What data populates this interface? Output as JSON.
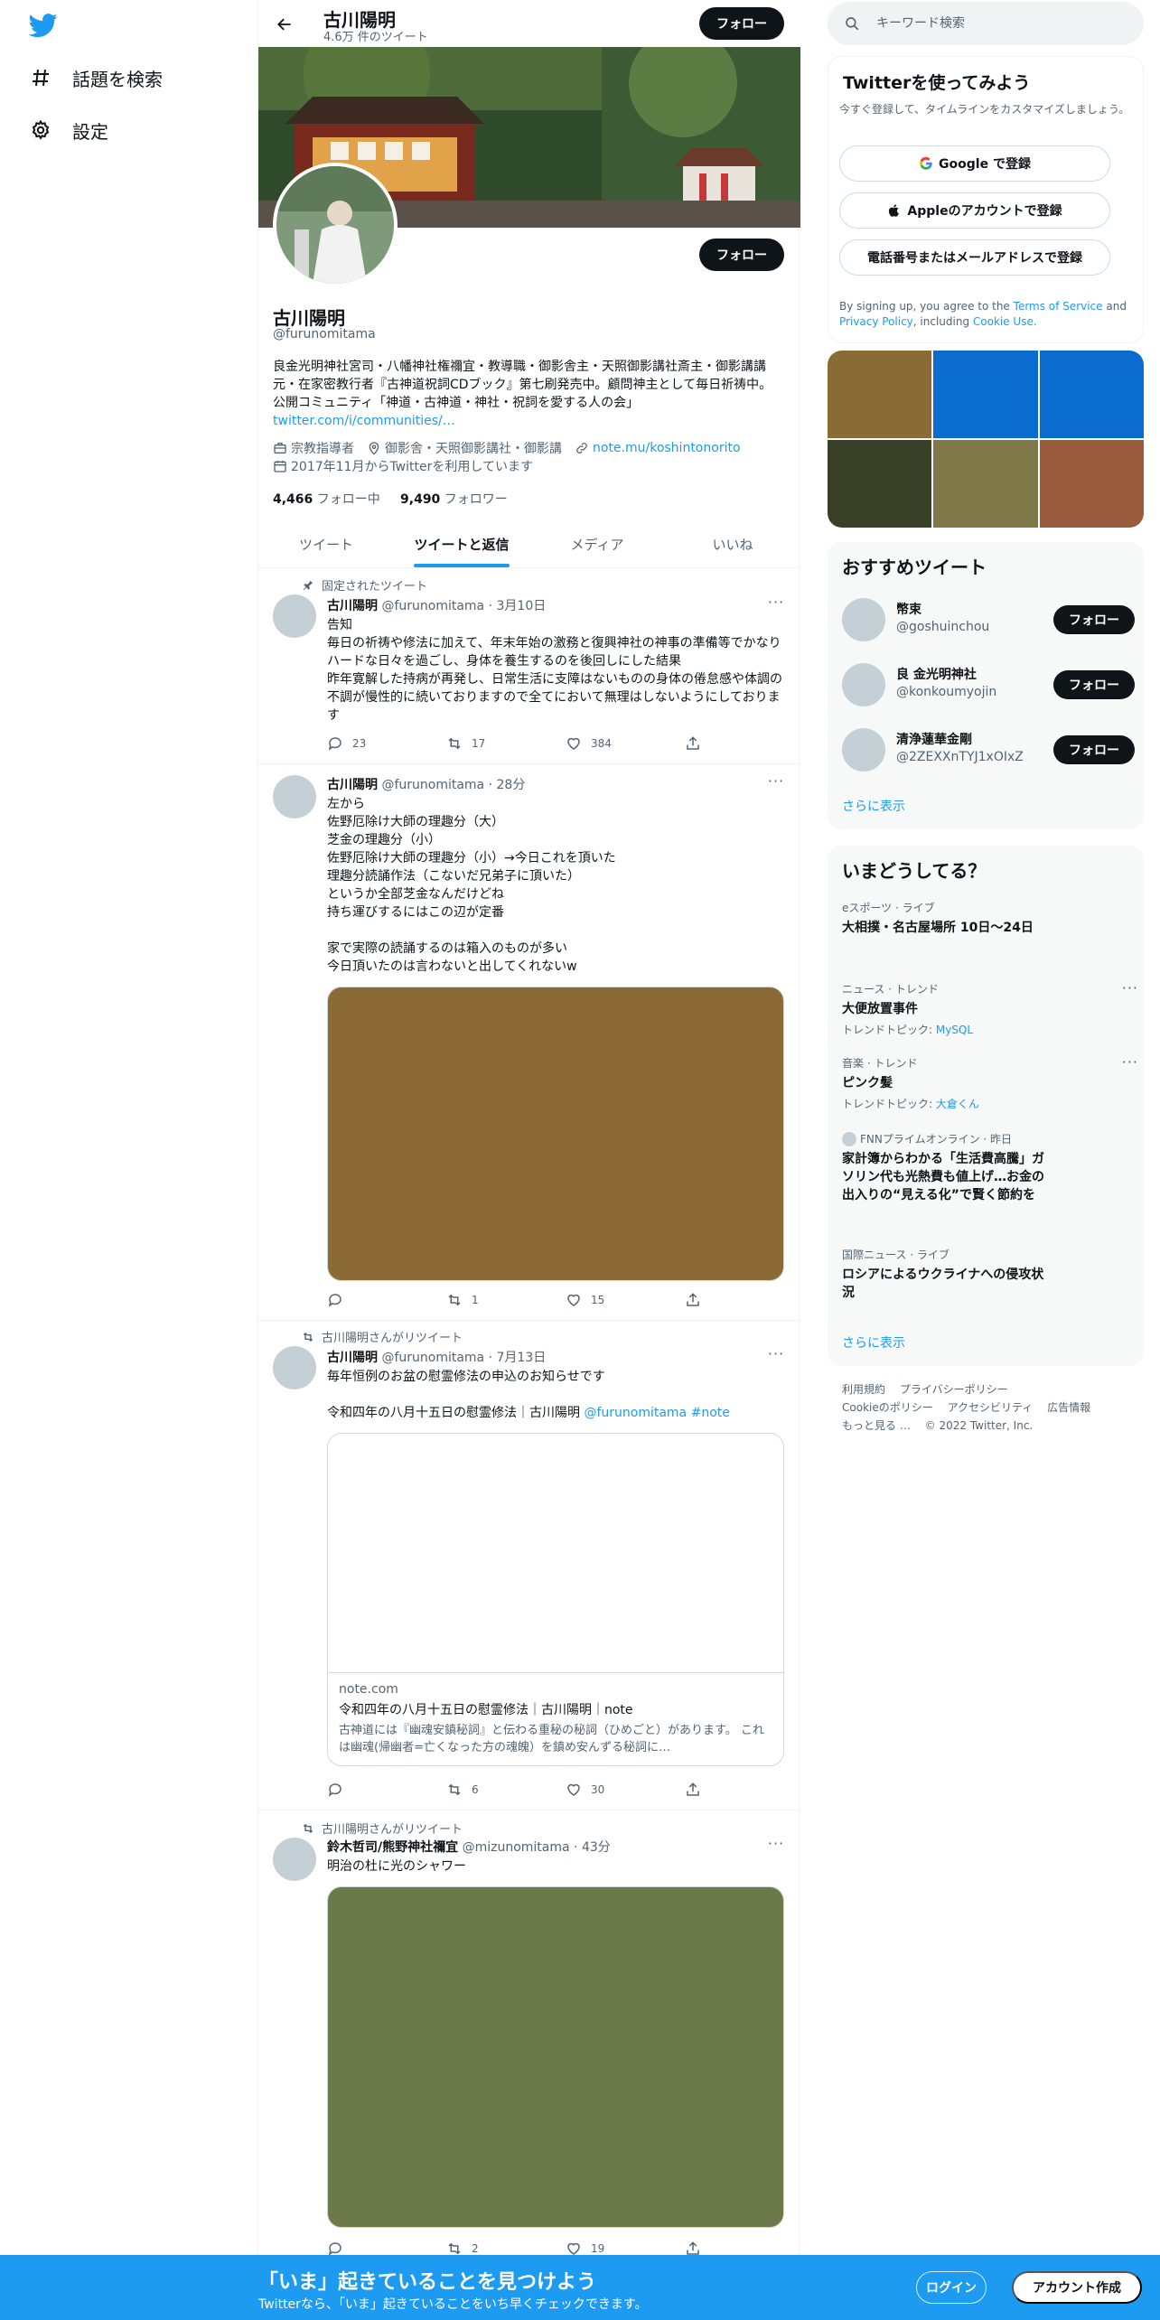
{
  "nav": {
    "items": [
      {
        "label": "話題を検索",
        "icon": "hash-icon"
      },
      {
        "label": "設定",
        "icon": "gear-icon"
      }
    ]
  },
  "header": {
    "name": "古川陽明",
    "tweet_count": "4.6万 件のツイート",
    "follow_label": "フォロー"
  },
  "profile": {
    "name": "古川陽明",
    "handle": "@furunomitama",
    "follow_label": "フォロー",
    "bio": "良金光明神社宮司・八幡神社権禰宜・教導職・御影舎主・天照御影講社斎主・御影講講元・在家密教行者『古神道祝詞CDブック』第七刷発売中。顧問神主として毎日祈祷中。公開コミュニティ「神道・古神道・神社・祝詞を愛する人の会」",
    "bio_link": "twitter.com/i/communities/…",
    "category": "宗教指導者",
    "location": "御影舎・天照御影講社・御影講",
    "website": "note.mu/koshintonorito",
    "joined": "2017年11月からTwitterを利用しています",
    "following_count": "4,466",
    "following_label": "フォロー中",
    "followers_count": "9,490",
    "followers_label": "フォロワー"
  },
  "tabs": [
    {
      "label": "ツイート",
      "active": false
    },
    {
      "label": "ツイートと返信",
      "active": true
    },
    {
      "label": "メディア",
      "active": false
    },
    {
      "label": "いいね",
      "active": false
    }
  ],
  "tweets": [
    {
      "social": "固定されたツイート",
      "name": "古川陽明",
      "handle": "@furunomitama",
      "time": "3月10日",
      "text": "告知\n毎日の祈祷や修法に加えて、年末年始の激務と復興神社の神事の準備等でかなりハードな日々を過ごし、身体を養生するのを後回しにした結果\n昨年寛解した持病が再発し、日常生活に支障はないものの身体の倦怠感や体調の不調が慢性的に続いておりますので全てにおいて無理はしないようにしております",
      "replies": "23",
      "retweets": "17",
      "likes": "384"
    },
    {
      "social": "",
      "name": "古川陽明",
      "handle": "@furunomitama",
      "time": "28分",
      "text": "左から\n佐野厄除け大師の理趣分（大）\n芝金の理趣分（小）\n佐野厄除け大師の理趣分（小）→今日これを頂いた\n理趣分読誦作法（こないだ兄弟子に頂いた）\nというか全部芝金なんだけどね\n持ち運びするにはこの辺が定番\n\n家で実際の読誦するのは箱入のものが多い\n今日頂いたのは言わないと出してくれないw",
      "media_color": "#8b6a35",
      "replies": "",
      "retweets": "1",
      "likes": "15"
    },
    {
      "social": "古川陽明さんがリツイート",
      "name": "古川陽明",
      "handle": "@furunomitama",
      "time": "7月13日",
      "text": "毎年恒例のお盆の慰霊修法の申込のお知らせです",
      "text2": "令和四年の八月十五日の慰霊修法｜古川陽明",
      "text2_link": "@furunomitama #note",
      "card_domain": "note.com",
      "card_title": "令和四年の八月十五日の慰霊修法｜古川陽明｜note",
      "card_desc": "古神道には『幽魂安鎮秘詞』と伝わる重秘の秘詞（ひめごと）があります。 これは幽魂(帰幽者=亡くなった方の魂魄）を鎮め安んずる秘詞に…",
      "replies": "",
      "retweets": "6",
      "likes": "30"
    },
    {
      "social": "古川陽明さんがリツイート",
      "name": "鈴木哲司/熊野神社禰宜",
      "handle": "@mizunomitama",
      "time": "43分",
      "text": "明治の杜に光のシャワー",
      "media_color": "#6b7a48",
      "replies": "",
      "retweets": "2",
      "likes": "19"
    }
  ],
  "search": {
    "placeholder": "キーワード検索"
  },
  "signup": {
    "title": "Twitterを使ってみよう",
    "subtitle": "今すぐ登録して、タイムラインをカスタマイズしましょう。",
    "google_label": "Google で登録",
    "apple_label": "Appleのアカウントで登録",
    "phone_label": "電話番号またはメールアドレスで登録",
    "legal_prefix": "By signing up, you agree to the",
    "terms": "Terms of Service",
    "and": "and",
    "privacy": "Privacy Policy",
    "including": ", including",
    "cookie": "Cookie Use."
  },
  "photo_grid_colors": [
    "#8a6a35",
    "#0a6ccf",
    "#0a6ccf",
    "#3a3f28",
    "#7e7848",
    "#9a5a3c"
  ],
  "recommended": {
    "title": "おすすめツイート",
    "users": [
      {
        "name": "幣束",
        "handle": "@goshuinchou"
      },
      {
        "name": "良 金光明神社",
        "handle": "@konkoumyojin"
      },
      {
        "name": "清浄蓮華金剛",
        "handle": "@2ZEXXnTYJ1xOIxZ"
      }
    ],
    "follow_label": "フォロー",
    "more": "さらに表示"
  },
  "trends": {
    "title": "いまどうしてる？",
    "items": [
      {
        "context": "eスポーツ · ライブ",
        "name": "大相撲・名古屋場所 10日〜24日",
        "topic_prefix": "",
        "topic": ""
      },
      {
        "context": "ニュース · トレンド",
        "name": "大便放置事件",
        "topic_prefix": "トレンドトピック: ",
        "topic": "MySQL"
      },
      {
        "context": "音楽 · トレンド",
        "name": "ピンク髪",
        "topic_prefix": "トレンドトピック: ",
        "topic": "大倉くん"
      },
      {
        "context": "FNNプライムオンライン · 昨日",
        "name": "家計簿からわかる「生活費高騰」ガソリン代も光熱費も値上げ…お金の出入りの“見える化”で賢く節約を",
        "topic_prefix": "",
        "topic": ""
      },
      {
        "context": "国際ニュース · ライブ",
        "name": "ロシアによるウクライナへの侵攻状況",
        "topic_prefix": "",
        "topic": ""
      }
    ],
    "more": "さらに表示"
  },
  "footer": {
    "links": [
      "利用規約",
      "プライバシーポリシー",
      "Cookieのポリシー",
      "アクセシビリティ",
      "広告情報",
      "もっと見る …",
      "© 2022 Twitter, Inc."
    ]
  },
  "bottom_bar": {
    "title": "「いま」起きていることを見つけよう",
    "subtitle": "Twitterなら、「いま」起きていることをいち早くチェックできます。",
    "login": "ログイン",
    "signup": "アカウント作成"
  }
}
